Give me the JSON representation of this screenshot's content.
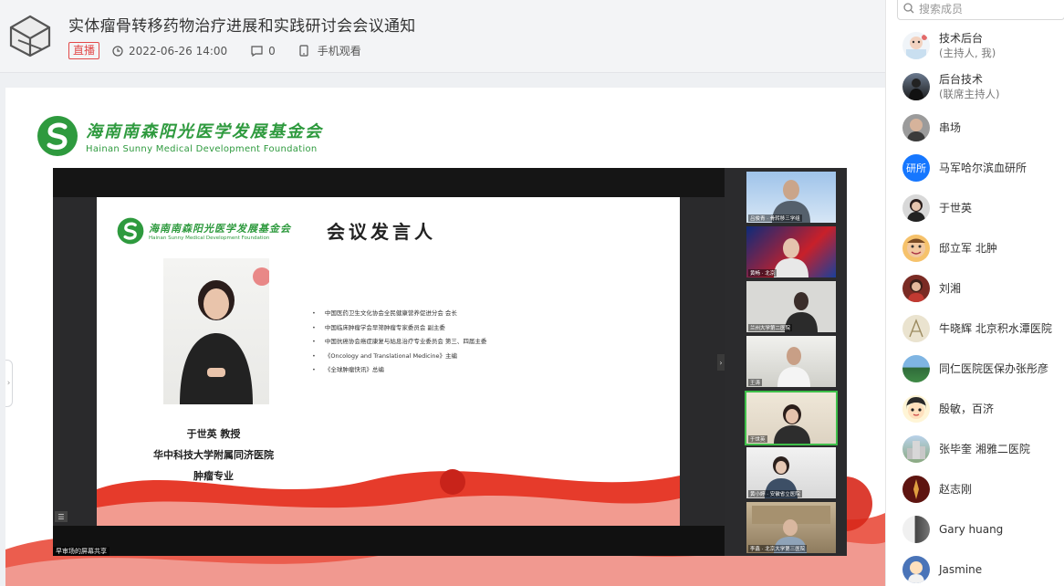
{
  "header": {
    "title": "实体瘤骨转移药物治疗进展和实践研讨会会议通知",
    "live_badge": "直播",
    "datetime": "2022-06-26 14:00",
    "comments": "0",
    "mobile_watch": "手机观看"
  },
  "foundation": {
    "name_cn": "海南南森阳光医学发展基金会",
    "name_en": "Hainan Sunny Medical Development Foundation"
  },
  "slide": {
    "heading": "会议发言人",
    "speaker_name": "于世英 教授",
    "speaker_org": "华中科技大学附属同济医院",
    "speaker_dept": "肿瘤专业",
    "bullets": [
      "中国医药卫生文化协会全民健康营养促进分会 会长",
      "中国临床肿瘤学会早筛肿瘤专家委员会 副主委",
      "中国抗癌协会癌症康复与姑息治疗专业委员会 第三、四届主委",
      "《Oncology and Translational Medicine》主编",
      "《全球肿瘤快讯》总编"
    ],
    "share_text": "早审场的屏幕共享"
  },
  "gallery": [
    {
      "label": "吕俊青 · 骨转移三学组"
    },
    {
      "label": "黄畅 · 北京"
    },
    {
      "label": "兰州大学第二医院"
    },
    {
      "label": "王涛"
    },
    {
      "label": "于世英"
    },
    {
      "label": "黄小婷 · 安徽省立医院"
    },
    {
      "label": "李鑫 · 北京大学第三医院"
    }
  ],
  "members": {
    "search_placeholder": "搜索成员",
    "items": [
      {
        "name": "技术后台",
        "role": "(主持人, 我)",
        "avatar": "cartoon"
      },
      {
        "name": "后台技术",
        "role": "(联席主持人)",
        "avatar": "dark"
      },
      {
        "name": "串场",
        "role": "",
        "avatar": "photo1"
      },
      {
        "name": "马军哈尔滨血研所",
        "role": "",
        "avatar": "text",
        "avatar_text": "研所"
      },
      {
        "name": "于世英",
        "role": "",
        "avatar": "photo2"
      },
      {
        "name": "邸立军 北肿",
        "role": "",
        "avatar": "cartoon2"
      },
      {
        "name": "刘湘",
        "role": "",
        "avatar": "photo3"
      },
      {
        "name": "牛晓辉 北京积水潭医院",
        "role": "",
        "avatar": "sketch"
      },
      {
        "name": "同仁医院医保办张彤彦",
        "role": "",
        "avatar": "landscape"
      },
      {
        "name": "殷敏，百济",
        "role": "",
        "avatar": "cartoon3"
      },
      {
        "name": "张毕奎 湘雅二医院",
        "role": "",
        "avatar": "building"
      },
      {
        "name": "赵志刚",
        "role": "",
        "avatar": "red"
      },
      {
        "name": "Gary huang",
        "role": "",
        "avatar": "stripe"
      },
      {
        "name": "Jasmine",
        "role": "",
        "avatar": "blue"
      }
    ]
  },
  "colors": {
    "brand_green": "#2e9a3e",
    "live_red": "#e24a4a",
    "active_tile": "#3fbf4a",
    "avatar_blue": "#1677ff"
  }
}
